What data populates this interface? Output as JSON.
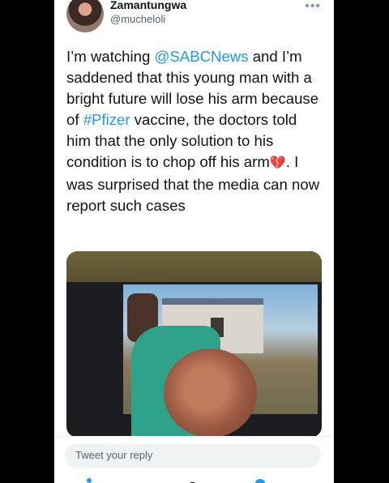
{
  "tweet": {
    "display_name": "Zamantungwa",
    "handle": "@mucheloli",
    "text_1": "I’m watching ",
    "mention": "@SABCNews",
    "text_2": " and I’m saddened that this young man with a bright future will lose his arm because of ",
    "hashtag": "#Pfizer",
    "text_3": " vaccine, the doctors told him that the only solution to his condition is to chop off his arm",
    "emoji": "💔",
    "text_4": ". I was surprised that the media can now report such cases"
  },
  "reply": {
    "placeholder": "Tweet your reply"
  },
  "colors": {
    "link": "#1d9bf0",
    "background": "#000000"
  }
}
